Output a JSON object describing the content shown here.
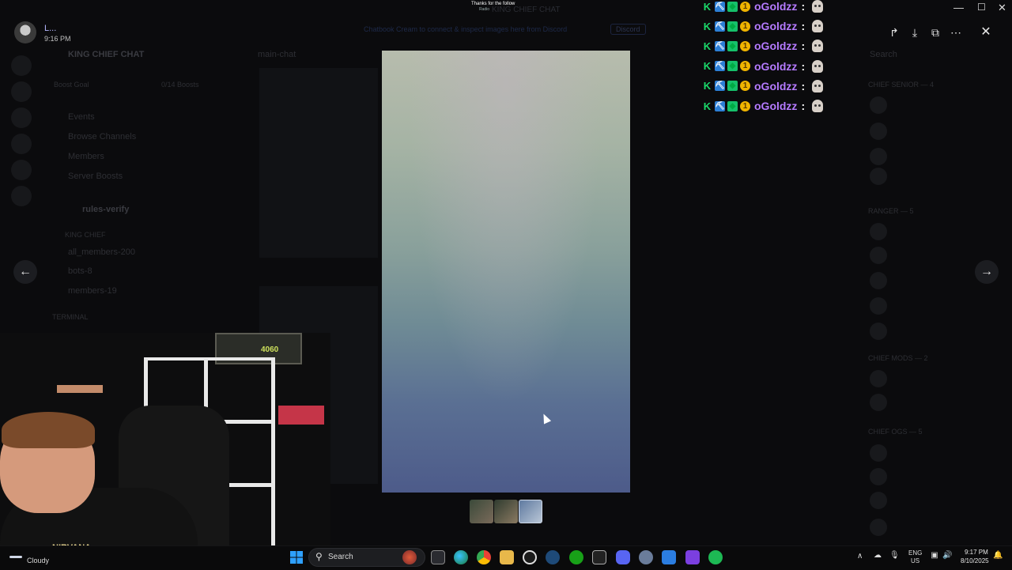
{
  "top_bar": {
    "username": "L...",
    "time": "9:16 PM",
    "banner_text": "Chatbook Cream to connect & inspect images here from Discord",
    "banner_button": "Discord",
    "toast_title": "Thanks for the follow",
    "toast_sub": "Radio",
    "dim_title": "KING CHIEF CHAT"
  },
  "discord_bg": {
    "server_name": "KING CHIEF CHAT",
    "channel": "main-chat",
    "boost_goal": "Boost Goal",
    "boosts": "0/14 Boosts",
    "sidebar_items": [
      "Events",
      "Browse Channels",
      "Members",
      "Server Boosts"
    ],
    "channels": [
      "rules-verify",
      "all_members-200",
      "bots-8",
      "members-19"
    ],
    "categories": [
      "KING CHIEF",
      "TERMINAL"
    ],
    "member_sections": [
      "CHIEF SENIOR — 4",
      "RANGER — 5",
      "CHIEF MODS — 2",
      "CHIEF OGS — 5"
    ],
    "search_placeholder": "Search"
  },
  "viewer": {
    "toolbar": {
      "forward": "forward-icon",
      "download": "download-icon",
      "open_external": "open-external-icon",
      "more": "more-icon",
      "close": "close-icon"
    },
    "thumbnail_count": 3
  },
  "window_controls": {
    "minimize": "—",
    "maximize": "☐",
    "close": "✕"
  },
  "chat_overlay": {
    "messages": [
      {
        "user": "oGoldzz",
        "colon": ":"
      },
      {
        "user": "oGoldzz",
        "colon": ":"
      },
      {
        "user": "oGoldzz",
        "colon": ":"
      },
      {
        "user": "oGoldzz",
        "colon": ":"
      },
      {
        "user": "oGoldzz",
        "colon": ":"
      },
      {
        "user": "oGoldzz",
        "colon": ":"
      }
    ],
    "badge_glyphs": {
      "k": "K",
      "pick": "⛏",
      "gem": "◆",
      "one": "1"
    },
    "user_color": "#b57bff"
  },
  "webcam": {
    "gpu_label": "4060",
    "shirt_text": "NIRVANA"
  },
  "taskbar": {
    "weather": "Cloudy",
    "search_label": "Search",
    "lang_1": "ENG",
    "lang_2": "US",
    "time": "9:17 PM",
    "date": "8/10/2025"
  }
}
